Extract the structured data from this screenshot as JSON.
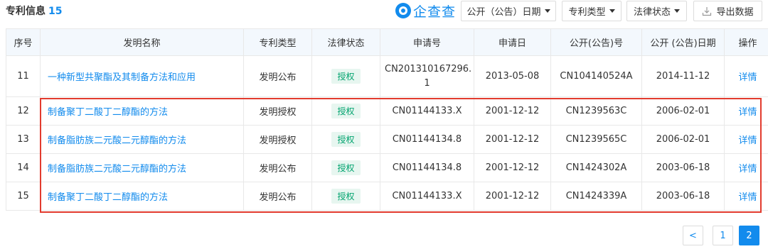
{
  "header": {
    "title": "专利信息",
    "count": "15",
    "brand": "企查查",
    "buttons": {
      "pub_date": "公开（公告）日期",
      "patent_type": "专利类型",
      "legal_status": "法律状态",
      "export": "导出数据"
    }
  },
  "table": {
    "columns": [
      "序号",
      "发明名称",
      "专利类型",
      "法律状态",
      "申请号",
      "申请日",
      "公开(公告)号",
      "公开 (公告)日期",
      "操作"
    ],
    "rows": [
      {
        "no": "11",
        "name": "一种新型共聚酯及其制备方法和应用",
        "type": "发明公布",
        "status": "授权",
        "app_no_line1": "CN201310167296.",
        "app_no_line2": "1",
        "app_date": "2013-05-08",
        "pub_no": "CN104140524A",
        "pub_date": "2014-11-12",
        "action": "详情"
      },
      {
        "no": "12",
        "name": "制备聚丁二酸丁二醇酯的方法",
        "type": "发明授权",
        "status": "授权",
        "app_no": "CN01144133.X",
        "app_date": "2001-12-12",
        "pub_no": "CN1239563C",
        "pub_date": "2006-02-01",
        "action": "详情"
      },
      {
        "no": "13",
        "name": "制备脂肪族二元酸二元醇酯的方法",
        "type": "发明授权",
        "status": "授权",
        "app_no": "CN01144134.8",
        "app_date": "2001-12-12",
        "pub_no": "CN1239565C",
        "pub_date": "2006-02-01",
        "action": "详情"
      },
      {
        "no": "14",
        "name": "制备脂肪族二元酸二元醇酯的方法",
        "type": "发明公布",
        "status": "授权",
        "app_no": "CN01144134.8",
        "app_date": "2001-12-12",
        "pub_no": "CN1424302A",
        "pub_date": "2003-06-18",
        "action": "详情"
      },
      {
        "no": "15",
        "name": "制备聚丁二酸丁二醇酯的方法",
        "type": "发明公布",
        "status": "授权",
        "app_no": "CN01144133.X",
        "app_date": "2001-12-12",
        "pub_no": "CN1424339A",
        "pub_date": "2003-06-18",
        "action": "详情"
      }
    ]
  },
  "pagination": {
    "prev": "<",
    "pages": [
      "1",
      "2"
    ],
    "current": "2"
  },
  "colors": {
    "accent": "#128bed",
    "status_green": "#00a36e",
    "highlight_red": "#e23b2e",
    "header_bg": "#f3f8fd"
  }
}
